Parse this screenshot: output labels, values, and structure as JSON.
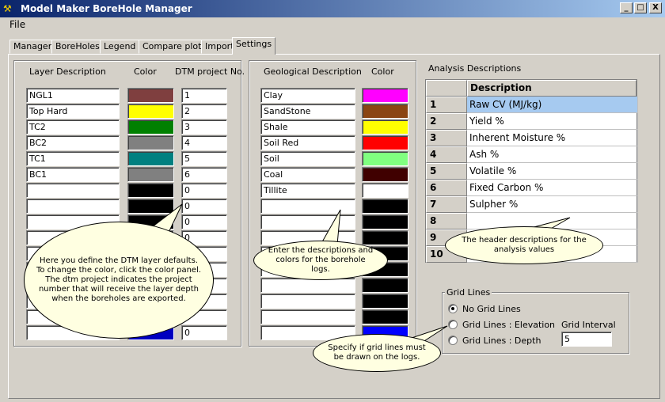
{
  "window": {
    "title": "Model Maker BoreHole Manager",
    "minimize_glyph": "_",
    "maximize_glyph": "□",
    "close_glyph": "X"
  },
  "menu": {
    "file": "File"
  },
  "tabs": [
    "Manager",
    "BoreHoles",
    "Legend",
    "Compare plots",
    "Import",
    "Settings"
  ],
  "layers": {
    "header_description": "Layer Description",
    "header_color": "Color",
    "header_dtm": "DTM project No.",
    "rows": [
      {
        "desc": "NGL1",
        "color": "#7f3f3f",
        "dtm": "1"
      },
      {
        "desc": "Top Hard",
        "color": "#ffff00",
        "dtm": "2"
      },
      {
        "desc": "TC2",
        "color": "#008000",
        "dtm": "3"
      },
      {
        "desc": "BC2",
        "color": "#808080",
        "dtm": "4"
      },
      {
        "desc": "TC1",
        "color": "#008080",
        "dtm": "5"
      },
      {
        "desc": "BC1",
        "color": "#808080",
        "dtm": "6"
      },
      {
        "desc": "",
        "color": "#000000",
        "dtm": "0"
      },
      {
        "desc": "",
        "color": "#000000",
        "dtm": "0"
      },
      {
        "desc": "",
        "color": "#000000",
        "dtm": "0"
      },
      {
        "desc": "",
        "color": "#000000",
        "dtm": "0"
      },
      {
        "desc": "",
        "color": "#000000",
        "dtm": "0"
      },
      {
        "desc": "",
        "color": "#000000",
        "dtm": "0"
      },
      {
        "desc": "",
        "color": "#000000",
        "dtm": "0"
      },
      {
        "desc": "",
        "color": "#000000",
        "dtm": "0"
      },
      {
        "desc": "",
        "color": "#000000",
        "dtm": "0"
      },
      {
        "desc": "",
        "color": "#0000c0",
        "dtm": "0"
      }
    ]
  },
  "geology": {
    "header_description": "Geological Description",
    "header_color": "Color",
    "rows": [
      {
        "desc": "Clay",
        "color": "#ff00ff"
      },
      {
        "desc": "SandStone",
        "color": "#8b4513"
      },
      {
        "desc": "Shale",
        "color": "#ffff00"
      },
      {
        "desc": "Soil Red",
        "color": "#ff0000"
      },
      {
        "desc": "Soil",
        "color": "#80ff80"
      },
      {
        "desc": "Coal",
        "color": "#400000"
      },
      {
        "desc": "Tillite",
        "color": "#ffffff"
      },
      {
        "desc": "",
        "color": "#000000"
      },
      {
        "desc": "",
        "color": "#000000"
      },
      {
        "desc": "",
        "color": "#000000"
      },
      {
        "desc": "",
        "color": "#000000"
      },
      {
        "desc": "",
        "color": "#000000"
      },
      {
        "desc": "",
        "color": "#000000"
      },
      {
        "desc": "",
        "color": "#000000"
      },
      {
        "desc": "",
        "color": "#000000"
      },
      {
        "desc": "",
        "color": "#0000ff"
      }
    ]
  },
  "analysis": {
    "title": "Analysis Descriptions",
    "column_header": "Description",
    "selected_row": 1,
    "selected_color": "#a6caf0",
    "rows": [
      {
        "num": "1",
        "desc": "Raw CV (MJ/kg)"
      },
      {
        "num": "2",
        "desc": "Yield %"
      },
      {
        "num": "3",
        "desc": "Inherent Moisture %"
      },
      {
        "num": "4",
        "desc": "Ash %"
      },
      {
        "num": "5",
        "desc": "Volatile %"
      },
      {
        "num": "6",
        "desc": "Fixed Carbon %"
      },
      {
        "num": "7",
        "desc": "Sulpher %"
      },
      {
        "num": "8",
        "desc": ""
      },
      {
        "num": "9",
        "desc": ""
      },
      {
        "num": "10",
        "desc": ""
      }
    ]
  },
  "grid_lines": {
    "title": "Grid Lines",
    "options": [
      {
        "label": "No Grid Lines",
        "selected": true
      },
      {
        "label": "Grid Lines : Elevation",
        "selected": false
      },
      {
        "label": "Grid Lines : Depth",
        "selected": false
      }
    ],
    "interval_label": "Grid Interval",
    "interval_value": "5"
  },
  "callouts": {
    "dtm": "Here you define the DTM layer defaults.\nTo change the color, click the color panel.\nThe dtm project indicates the project number that will receive the layer depth when the boreholes are exported.",
    "geology": "Enter the descriptions and colors for the borehole logs.",
    "analysis": "The header descriptions for the analysis values",
    "gridlines": "Specify if grid lines must be drawn on the logs."
  }
}
